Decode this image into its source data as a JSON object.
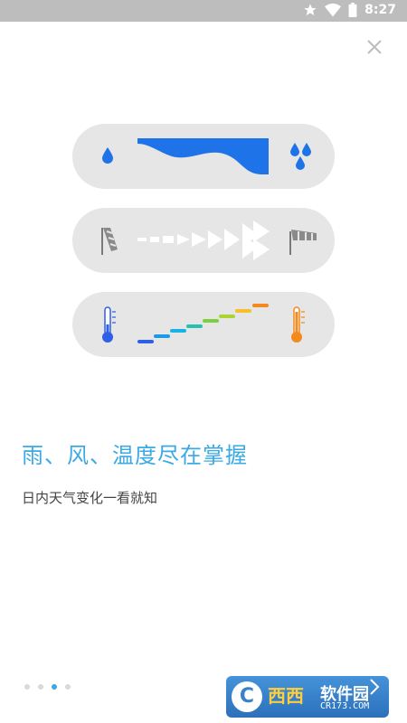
{
  "status_bar": {
    "time": "8:27",
    "icons": [
      "star-icon",
      "wifi-icon",
      "battery-icon"
    ]
  },
  "close_icon": "close-icon",
  "cards": [
    {
      "name": "rain",
      "left_icon": "water-drop-icon",
      "right_icon": "water-drops-icon"
    },
    {
      "name": "wind",
      "left_icon": "windsock-low-icon",
      "right_icon": "windsock-high-icon"
    },
    {
      "name": "temperature",
      "left_icon": "thermometer-cold-icon",
      "right_icon": "thermometer-hot-icon"
    }
  ],
  "headline": "雨、风、温度尽在掌握",
  "subtitle": "日内天气变化一看就知",
  "pager": {
    "count": 4,
    "active_index": 2
  },
  "next_icon": "chevron-right-icon",
  "watermark": {
    "text_red": "西西",
    "text_site": "软件园",
    "text_url": "CR173.COM"
  },
  "colors": {
    "accent": "#3aa9e4",
    "rain_blue": "#1e73e8",
    "card_bg": "#e6e6e6",
    "temp_gradient": [
      "#2e5fe6",
      "#19b3e3",
      "#31c77a",
      "#a8d532",
      "#f5c02a",
      "#f28a1e"
    ]
  }
}
